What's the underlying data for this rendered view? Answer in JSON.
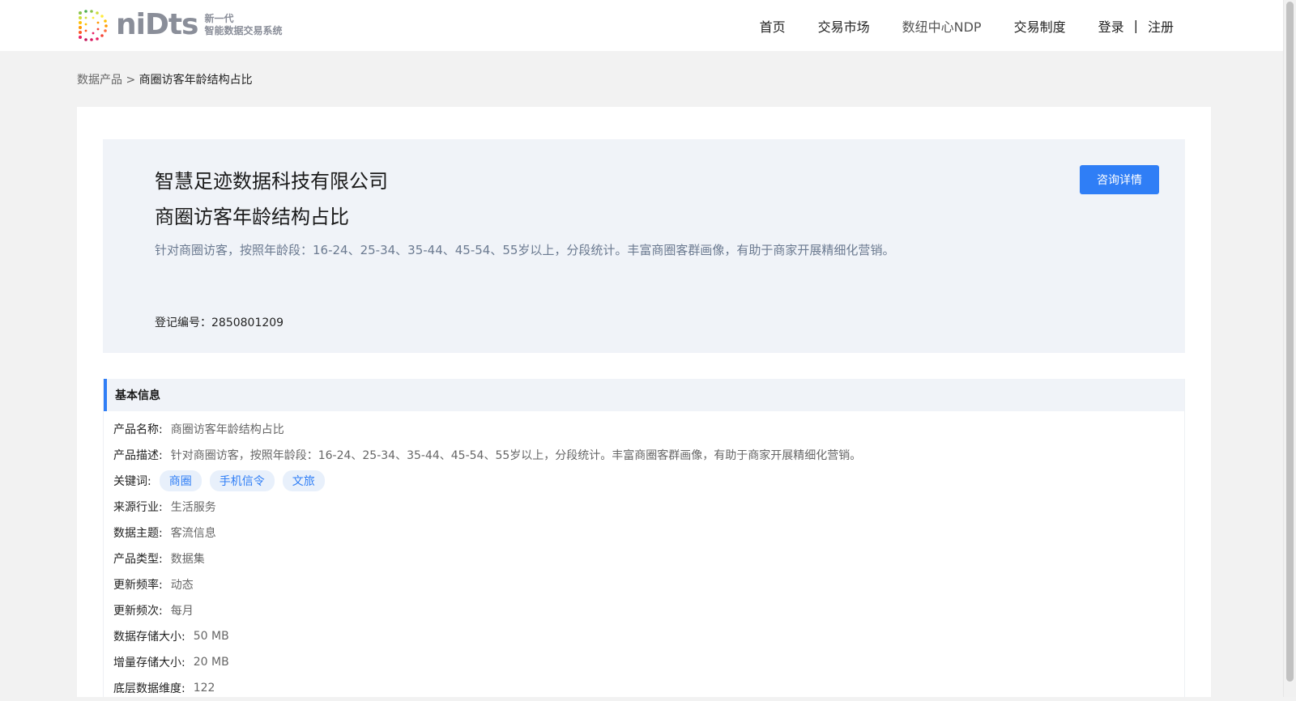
{
  "header": {
    "logo_word": "niDts",
    "logo_sub_line1": "新一代",
    "logo_sub_line2": "智能数据交易系统",
    "nav": [
      {
        "label": "首页"
      },
      {
        "label": "交易市场"
      },
      {
        "label": "数纽中心NDP"
      },
      {
        "label": "交易制度"
      }
    ],
    "login_label": "登录",
    "separator": "|",
    "register_label": "注册"
  },
  "breadcrumb": {
    "parent": "数据产品",
    "arrow": ">",
    "current": "商圈访客年龄结构占比"
  },
  "hero": {
    "company": "智慧足迹数据科技有限公司",
    "product": "商圈访客年龄结构占比",
    "description": "针对商圈访客，按照年龄段：16-24、25-34、35-44、45-54、55岁以上，分段统计。丰富商圈客群画像，有助于商家开展精细化营销。",
    "reg_label": "登记编号：",
    "reg_no": "2850801209",
    "consult_button": "咨询详情"
  },
  "basic_info": {
    "title": "基本信息",
    "name_label": "产品名称:",
    "name_value": "商圈访客年龄结构占比",
    "desc_label": "产品描述:",
    "desc_value": "针对商圈访客，按照年龄段：16-24、25-34、35-44、45-54、55岁以上，分段统计。丰富商圈客群画像，有助于商家开展精细化营销。",
    "keywords_label": "关键词:",
    "keywords": [
      "商圈",
      "手机信令",
      "文旅"
    ],
    "industry_label": "来源行业:",
    "industry_value": "生活服务",
    "theme_label": "数据主题:",
    "theme_value": "客流信息",
    "type_label": "产品类型:",
    "type_value": "数据集",
    "freq_label": "更新频率:",
    "freq_value": "动态",
    "cadence_label": "更新频次:",
    "cadence_value": "每月",
    "storage_label": "数据存储大小:",
    "storage_value": "50 MB",
    "incr_label": "增量存储大小:",
    "incr_value": "20 MB",
    "dim_label": "底层数据维度:",
    "dim_value": "122"
  },
  "colors": {
    "accent": "#2f7ef6",
    "hero_bg": "#f0f3f8",
    "page_bg": "#f2f2f2"
  }
}
